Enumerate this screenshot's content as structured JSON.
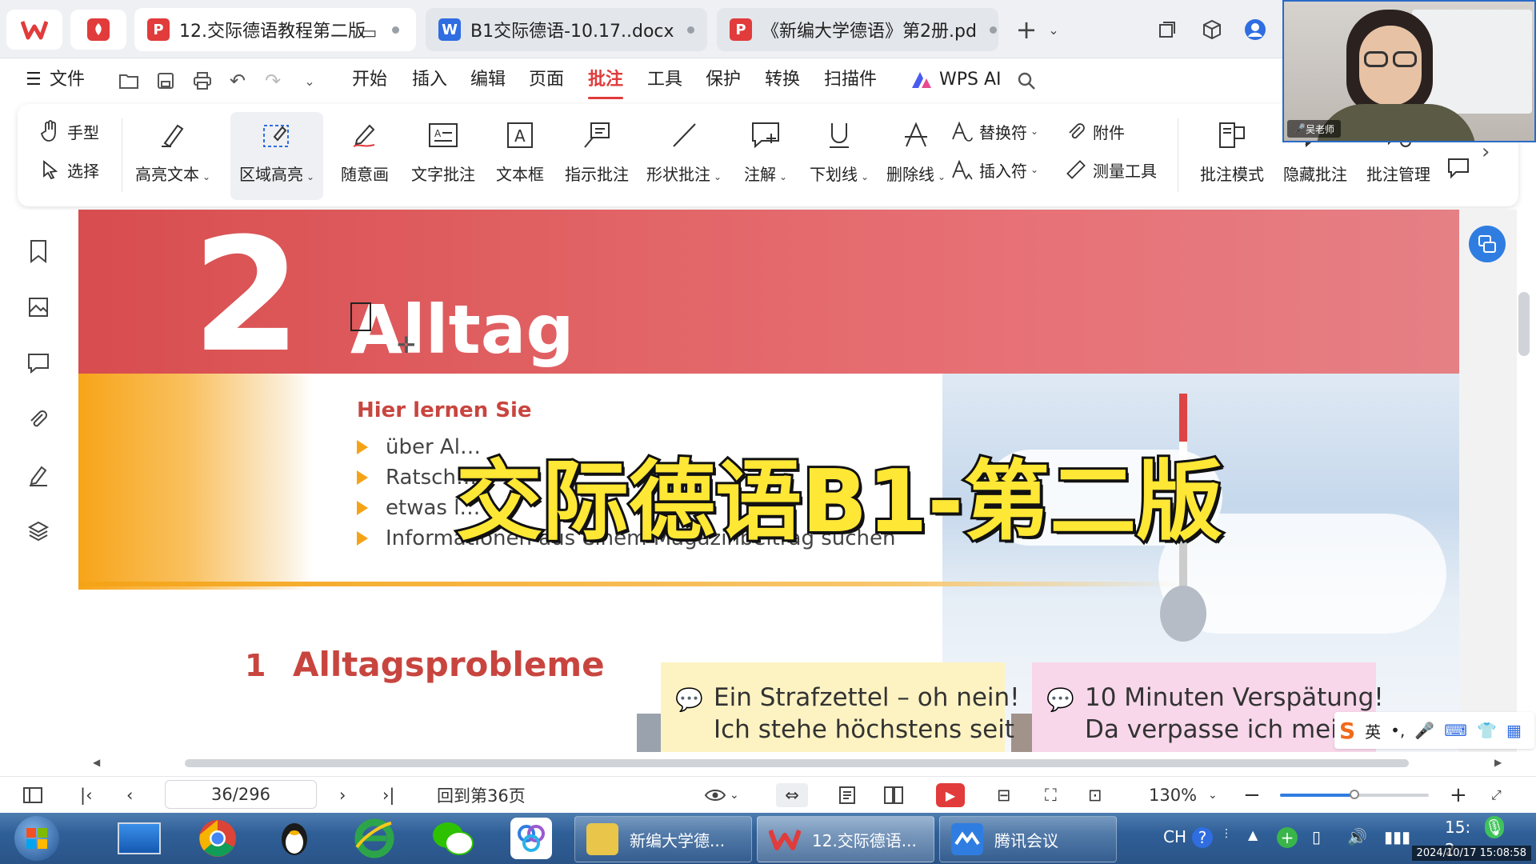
{
  "tabs": [
    {
      "label": "12.交际德语教程第二版",
      "icon_letter": "P",
      "icon_color": "#e13b3b",
      "active": true
    },
    {
      "label": "B1交际德语-10.17..docx",
      "icon_letter": "W",
      "icon_color": "#2f6de1",
      "active": false
    },
    {
      "label": "《新编大学德语》第2册.pd",
      "icon_letter": "P",
      "icon_color": "#e13b3b",
      "active": false
    }
  ],
  "menu": {
    "file": "文件",
    "items": [
      "开始",
      "插入",
      "编辑",
      "页面",
      "批注",
      "工具",
      "保护",
      "转换",
      "扫描件"
    ],
    "active": "批注",
    "wps_ai": "WPS AI"
  },
  "ribbon": {
    "hand": "手型",
    "select": "选择",
    "highlight_text": "高亮文本",
    "area_highlight": "区域高亮",
    "freehand": "随意画",
    "text_comment": "文字批注",
    "textbox": "文本框",
    "pointer_comment": "指示批注",
    "shape_comment": "形状批注",
    "annotation": "注解",
    "underline": "下划线",
    "strikethrough": "删除线",
    "replace_mark": "替换符",
    "insert_mark": "插入符",
    "attachment": "附件",
    "measure": "测量工具",
    "comment_mode": "批注模式",
    "hide_comments": "隐藏批注",
    "manage_comments": "批注管理"
  },
  "document": {
    "chapter_number": "2",
    "chapter_title": "Alltag",
    "learn_heading": "Hier lernen Sie",
    "bullets": [
      "über Al…",
      "Ratsch…",
      "etwas l…",
      "Informationen aus einem Magazinbeitrag suchen"
    ],
    "section_number": "1",
    "section_title": "Alltagsprobleme",
    "note1": {
      "line1": "Ein Strafzettel – oh nein!",
      "line2": "Ich stehe höchstens seit"
    },
    "note2": {
      "line1": "10 Minuten Verspätung!",
      "line2": "Da verpasse ich meinen"
    },
    "overlay_title": "交际德语B1-第二版"
  },
  "status": {
    "page_indicator": "36/296",
    "back_to_page": "回到第36页",
    "zoom": "130%",
    "zoom_fraction": 0.5
  },
  "taskbar": {
    "apps": [
      {
        "label": "新编大学德...",
        "color": "#e9c54a"
      },
      {
        "label": "12.交际德语...",
        "color": "#e13b3b"
      },
      {
        "label": "腾讯会议",
        "color": "#2f7de1"
      }
    ],
    "lang": "CH",
    "time_partial": "15:",
    "date_partial": "2"
  },
  "video": {
    "name_tag": "吴老师",
    "timestamp": "2024/10/17 15:08:58"
  },
  "ime": {
    "lang": "英"
  }
}
